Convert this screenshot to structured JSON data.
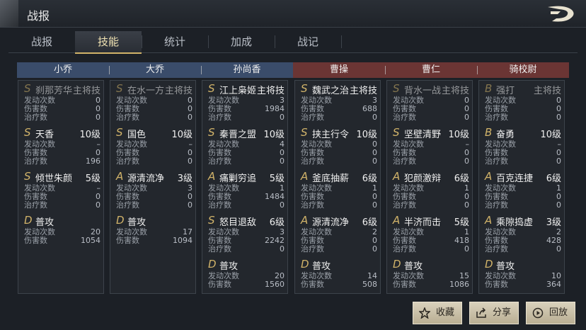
{
  "header": {
    "title": "战报"
  },
  "tabs": [
    {
      "label": "战报"
    },
    {
      "label": "技能"
    },
    {
      "label": "统计"
    },
    {
      "label": "加成"
    },
    {
      "label": "战记"
    }
  ],
  "active_tab": "技能",
  "generals": [
    {
      "name": "小乔",
      "side": "blue",
      "skills": [
        {
          "grade": "S",
          "name": "刹那芳华",
          "level": "主将技",
          "dim": true,
          "stats": [
            {
              "label": "发动次数",
              "value": "0"
            },
            {
              "label": "伤害数",
              "value": "0"
            },
            {
              "label": "治疗数",
              "value": "0"
            }
          ]
        },
        {
          "grade": "S",
          "name": "天香",
          "level": "10级",
          "dim": false,
          "stats": [
            {
              "label": "发动次数",
              "value": "–"
            },
            {
              "label": "伤害数",
              "value": "0"
            },
            {
              "label": "治疗数",
              "value": "196"
            }
          ]
        },
        {
          "grade": "S",
          "name": "倾世朱颜",
          "level": "5级",
          "dim": false,
          "stats": [
            {
              "label": "发动次数",
              "value": "–"
            },
            {
              "label": "伤害数",
              "value": "0"
            },
            {
              "label": "治疗数",
              "value": "0"
            }
          ]
        },
        {
          "grade": "D",
          "name": "普攻",
          "level": "",
          "dim": false,
          "stats": [
            {
              "label": "发动次数",
              "value": "20"
            },
            {
              "label": "伤害数",
              "value": "1054"
            }
          ]
        }
      ]
    },
    {
      "name": "大乔",
      "side": "blue",
      "skills": [
        {
          "grade": "S",
          "name": "在水一方",
          "level": "主将技",
          "dim": true,
          "stats": [
            {
              "label": "发动次数",
              "value": "0"
            },
            {
              "label": "伤害数",
              "value": "0"
            },
            {
              "label": "治疗数",
              "value": "0"
            }
          ]
        },
        {
          "grade": "S",
          "name": "国色",
          "level": "10级",
          "dim": false,
          "stats": [
            {
              "label": "发动次数",
              "value": "–"
            },
            {
              "label": "伤害数",
              "value": "0"
            },
            {
              "label": "治疗数",
              "value": "0"
            }
          ]
        },
        {
          "grade": "A",
          "name": "源清流净",
          "level": "3级",
          "dim": false,
          "stats": [
            {
              "label": "发动次数",
              "value": "3"
            },
            {
              "label": "伤害数",
              "value": "0"
            },
            {
              "label": "治疗数",
              "value": "0"
            }
          ]
        },
        {
          "grade": "D",
          "name": "普攻",
          "level": "",
          "dim": false,
          "stats": [
            {
              "label": "发动次数",
              "value": "17"
            },
            {
              "label": "伤害数",
              "value": "1094"
            }
          ]
        }
      ]
    },
    {
      "name": "孙尚香",
      "side": "blue",
      "skills": [
        {
          "grade": "S",
          "name": "江上枭姬",
          "level": "主将技",
          "dim": false,
          "stats": [
            {
              "label": "发动次数",
              "value": "3"
            },
            {
              "label": "伤害数",
              "value": "1984"
            },
            {
              "label": "治疗数",
              "value": "0"
            }
          ]
        },
        {
          "grade": "S",
          "name": "秦晋之盟",
          "level": "10级",
          "dim": false,
          "stats": [
            {
              "label": "发动次数",
              "value": "4"
            },
            {
              "label": "伤害数",
              "value": "0"
            },
            {
              "label": "治疗数",
              "value": "0"
            }
          ]
        },
        {
          "grade": "A",
          "name": "痛剿穷追",
          "level": "5级",
          "dim": false,
          "stats": [
            {
              "label": "发动次数",
              "value": "1"
            },
            {
              "label": "伤害数",
              "value": "1484"
            },
            {
              "label": "治疗数",
              "value": "0"
            }
          ]
        },
        {
          "grade": "S",
          "name": "怒目退敌",
          "level": "6级",
          "dim": false,
          "stats": [
            {
              "label": "发动次数",
              "value": "3"
            },
            {
              "label": "伤害数",
              "value": "2242"
            },
            {
              "label": "治疗数",
              "value": "0"
            }
          ]
        },
        {
          "grade": "D",
          "name": "普攻",
          "level": "",
          "dim": false,
          "stats": [
            {
              "label": "发动次数",
              "value": "20"
            },
            {
              "label": "伤害数",
              "value": "1560"
            }
          ]
        }
      ]
    },
    {
      "name": "曹操",
      "side": "red",
      "skills": [
        {
          "grade": "S",
          "name": "魏武之治",
          "level": "主将技",
          "dim": false,
          "stats": [
            {
              "label": "发动次数",
              "value": "3"
            },
            {
              "label": "伤害数",
              "value": "688"
            },
            {
              "label": "治疗数",
              "value": "0"
            }
          ]
        },
        {
          "grade": "S",
          "name": "挟主行令",
          "level": "10级",
          "dim": false,
          "stats": [
            {
              "label": "发动次数",
              "value": "0"
            },
            {
              "label": "伤害数",
              "value": "0"
            },
            {
              "label": "治疗数",
              "value": "0"
            }
          ]
        },
        {
          "grade": "A",
          "name": "釜底抽薪",
          "level": "6级",
          "dim": false,
          "stats": [
            {
              "label": "发动次数",
              "value": "1"
            },
            {
              "label": "伤害数",
              "value": "0"
            },
            {
              "label": "治疗数",
              "value": "0"
            }
          ]
        },
        {
          "grade": "A",
          "name": "源清流净",
          "level": "6级",
          "dim": false,
          "stats": [
            {
              "label": "发动次数",
              "value": "2"
            },
            {
              "label": "伤害数",
              "value": "0"
            },
            {
              "label": "治疗数",
              "value": "0"
            }
          ]
        },
        {
          "grade": "D",
          "name": "普攻",
          "level": "",
          "dim": false,
          "stats": [
            {
              "label": "发动次数",
              "value": "14"
            },
            {
              "label": "伤害数",
              "value": "508"
            }
          ]
        }
      ]
    },
    {
      "name": "曹仁",
      "side": "red",
      "skills": [
        {
          "grade": "S",
          "name": "背水一战",
          "level": "主将技",
          "dim": true,
          "stats": [
            {
              "label": "发动次数",
              "value": "0"
            },
            {
              "label": "伤害数",
              "value": "0"
            },
            {
              "label": "治疗数",
              "value": "0"
            }
          ]
        },
        {
          "grade": "S",
          "name": "坚壁清野",
          "level": "10级",
          "dim": false,
          "stats": [
            {
              "label": "发动次数",
              "value": "–"
            },
            {
              "label": "伤害数",
              "value": "0"
            },
            {
              "label": "治疗数",
              "value": "0"
            }
          ]
        },
        {
          "grade": "A",
          "name": "犯颜激辩",
          "level": "6级",
          "dim": false,
          "stats": [
            {
              "label": "发动次数",
              "value": "1"
            },
            {
              "label": "伤害数",
              "value": "0"
            },
            {
              "label": "治疗数",
              "value": "0"
            }
          ]
        },
        {
          "grade": "A",
          "name": "半济而击",
          "level": "5级",
          "dim": false,
          "stats": [
            {
              "label": "发动次数",
              "value": "1"
            },
            {
              "label": "伤害数",
              "value": "418"
            },
            {
              "label": "治疗数",
              "value": "0"
            }
          ]
        },
        {
          "grade": "D",
          "name": "普攻",
          "level": "",
          "dim": false,
          "stats": [
            {
              "label": "发动次数",
              "value": "15"
            },
            {
              "label": "伤害数",
              "value": "1086"
            }
          ]
        }
      ]
    },
    {
      "name": "骑校尉",
      "side": "red",
      "skills": [
        {
          "grade": "B",
          "name": "强打",
          "level": "主将技",
          "dim": true,
          "stats": [
            {
              "label": "发动次数",
              "value": "0"
            },
            {
              "label": "伤害数",
              "value": "0"
            },
            {
              "label": "治疗数",
              "value": "0"
            }
          ]
        },
        {
          "grade": "B",
          "name": "奋勇",
          "level": "10级",
          "dim": false,
          "stats": [
            {
              "label": "发动次数",
              "value": "–"
            },
            {
              "label": "伤害数",
              "value": "0"
            },
            {
              "label": "治疗数",
              "value": "0"
            }
          ]
        },
        {
          "grade": "A",
          "name": "百克连捷",
          "level": "6级",
          "dim": false,
          "stats": [
            {
              "label": "发动次数",
              "value": "1"
            },
            {
              "label": "伤害数",
              "value": "0"
            },
            {
              "label": "治疗数",
              "value": "0"
            }
          ]
        },
        {
          "grade": "A",
          "name": "乘隙捣虚",
          "level": "3级",
          "dim": false,
          "stats": [
            {
              "label": "发动次数",
              "value": "2"
            },
            {
              "label": "伤害数",
              "value": "428"
            },
            {
              "label": "治疗数",
              "value": "0"
            }
          ]
        },
        {
          "grade": "D",
          "name": "普攻",
          "level": "",
          "dim": false,
          "stats": [
            {
              "label": "发动次数",
              "value": "10"
            },
            {
              "label": "伤害数",
              "value": "364"
            }
          ]
        }
      ]
    }
  ],
  "buttons": [
    {
      "label": "收藏",
      "icon": "star-icon"
    },
    {
      "label": "分享",
      "icon": "share-icon"
    },
    {
      "label": "回放",
      "icon": "play-icon"
    }
  ],
  "colors": {
    "gold": "#d2b46a",
    "blue_header": "#3a4c6a",
    "red_header": "#6b3534"
  }
}
